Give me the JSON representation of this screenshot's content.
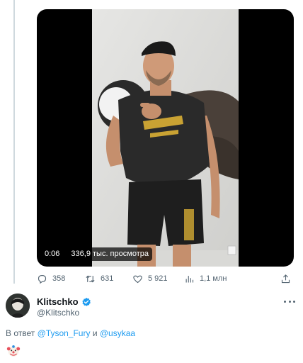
{
  "video": {
    "elapsed": "0:06",
    "views": "336,9 тыс. просмотра"
  },
  "actions": {
    "replies": "358",
    "retweets": "631",
    "likes": "5 921",
    "views": "1,1 млн"
  },
  "reply": {
    "display_name": "Klitschko",
    "handle": "@Klitschko",
    "reply_prefix": "В ответ",
    "mention_1": "@Tyson_Fury",
    "conjunction": "и",
    "mention_2": "@usykaa",
    "content_emoji": "clown-face-emoji"
  },
  "icons": {
    "reply": "reply-icon",
    "retweet": "retweet-icon",
    "like": "heart-icon",
    "views": "views-icon",
    "share": "share-icon",
    "verified": "verified-badge-icon",
    "more": "more-icon"
  },
  "colors": {
    "accent": "#1d9bf0",
    "secondary_text": "#536471",
    "thread_line": "#cfd9de"
  }
}
